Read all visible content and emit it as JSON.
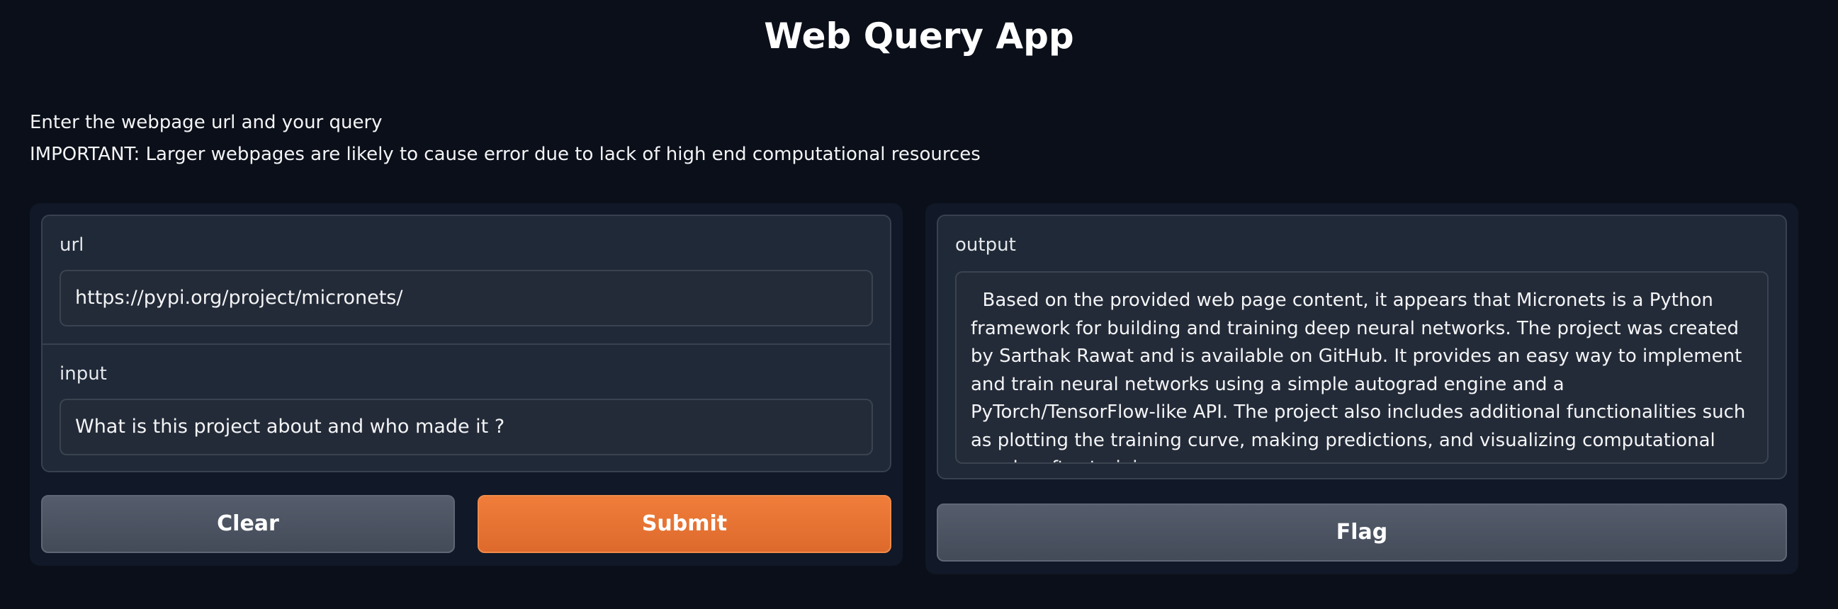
{
  "app": {
    "title": "Web Query App",
    "description_line1": "Enter the webpage url and your query",
    "description_line2": "IMPORTANT: Larger webpages are likely to cause error due to lack of high end computational resources"
  },
  "inputs": {
    "url": {
      "label": "url",
      "value": "https://pypi.org/project/micronets/"
    },
    "query": {
      "label": "input",
      "value": "What is this project about and who made it ?"
    }
  },
  "output": {
    "label": "output",
    "value": "  Based on the provided web page content, it appears that Micronets is a Python framework for building and training deep neural networks. The project was created by Sarthak Rawat and is available on GitHub. It provides an easy way to implement and train neural networks using a simple autograd engine and a PyTorch/TensorFlow-like API. The project also includes additional functionalities such as plotting the training curve, making predictions, and visualizing computational graphs after training."
  },
  "buttons": {
    "clear_label": "Clear",
    "submit_label": "Submit",
    "flag_label": "Flag"
  },
  "colors": {
    "background": "#0b0f19",
    "panel": "#111827",
    "primary": "#e8722f",
    "secondary": "#4b5260"
  }
}
